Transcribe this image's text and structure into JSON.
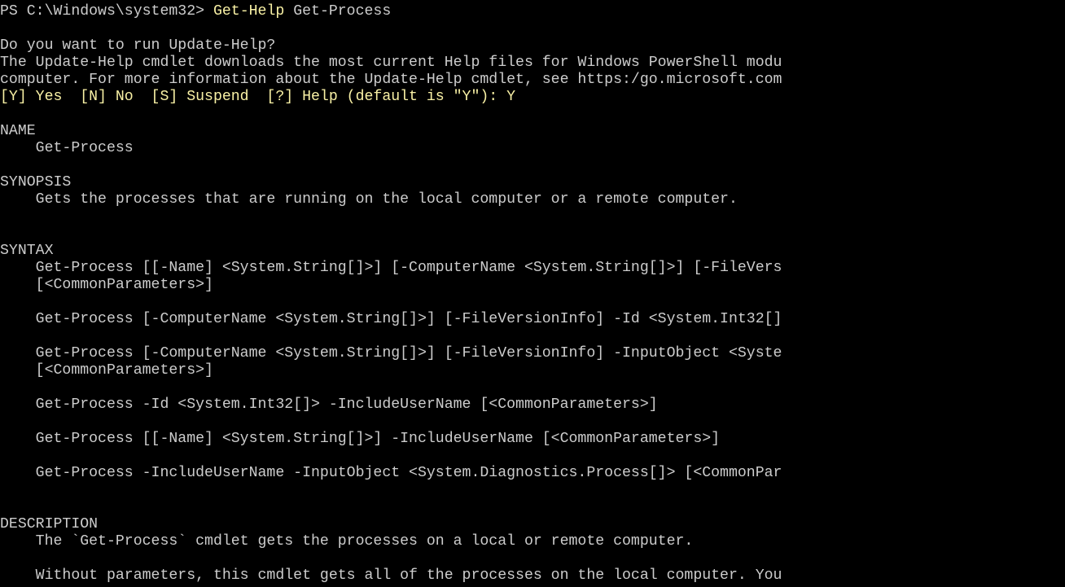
{
  "prompt": {
    "path": "PS C:\\Windows\\system32> ",
    "command": "Get-Help",
    "argument": " Get-Process"
  },
  "update_help": {
    "question": "Do you want to run Update-Help?",
    "line1": "The Update-Help cmdlet downloads the most current Help files for Windows PowerShell modu",
    "line2": "computer. For more information about the Update-Help cmdlet, see https:/go.microsoft.com",
    "choices": "[Y] Yes  [N] No  [S] Suspend  [?] Help (default is \"Y\"): Y"
  },
  "help": {
    "name_header": "NAME",
    "name_value": "    Get-Process",
    "synopsis_header": "SYNOPSIS",
    "synopsis_value": "    Gets the processes that are running on the local computer or a remote computer.",
    "syntax_header": "SYNTAX",
    "syntax_lines": [
      "    Get-Process [[-Name] <System.String[]>] [-ComputerName <System.String[]>] [-FileVers",
      "    [<CommonParameters>]",
      "    Get-Process [-ComputerName <System.String[]>] [-FileVersionInfo] -Id <System.Int32[]",
      "    Get-Process [-ComputerName <System.String[]>] [-FileVersionInfo] -InputObject <Syste",
      "    [<CommonParameters>]",
      "    Get-Process -Id <System.Int32[]> -IncludeUserName [<CommonParameters>]",
      "    Get-Process [[-Name] <System.String[]>] -IncludeUserName [<CommonParameters>]",
      "    Get-Process -IncludeUserName -InputObject <System.Diagnostics.Process[]> [<CommonPar"
    ],
    "description_header": "DESCRIPTION",
    "description_lines": [
      "    The `Get-Process` cmdlet gets the processes on a local or remote computer.",
      "    Without parameters, this cmdlet gets all of the processes on the local computer. You"
    ]
  },
  "colors": {
    "background": "#000000",
    "foreground": "#cccccc",
    "command": "#f9f1a5"
  }
}
